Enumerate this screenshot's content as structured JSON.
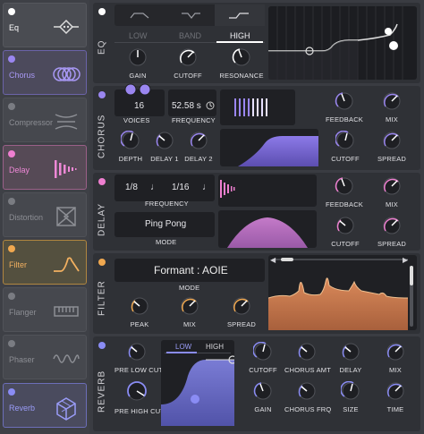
{
  "sidebar": {
    "modules": [
      {
        "label": "Eq",
        "active": true,
        "dot": "#ffffff",
        "label_color": "#ffffff"
      },
      {
        "label": "Chorus",
        "active": true,
        "dot": "#9a86f0",
        "label_color": "#a898f4"
      },
      {
        "label": "Compressor",
        "active": false,
        "dot": "#7a7c82",
        "label_color": "#8c8e94"
      },
      {
        "label": "Delay",
        "active": true,
        "dot": "#ee7fd0",
        "label_color": "#ee88d6"
      },
      {
        "label": "Distortion",
        "active": false,
        "dot": "#7a7c82",
        "label_color": "#8c8e94"
      },
      {
        "label": "Filter",
        "active": true,
        "dot": "#f0a850",
        "label_color": "#f2b060"
      },
      {
        "label": "Flanger",
        "active": false,
        "dot": "#7a7c82",
        "label_color": "#8c8e94"
      },
      {
        "label": "Phaser",
        "active": false,
        "dot": "#7a7c82",
        "label_color": "#8c8e94"
      },
      {
        "label": "Reverb",
        "active": true,
        "dot": "#8a8cf4",
        "label_color": "#9a9cf8"
      }
    ]
  },
  "eq": {
    "title": "EQ",
    "bands": [
      "LOW",
      "BAND",
      "HIGH"
    ],
    "selected_band": "HIGH",
    "knobs": [
      "GAIN",
      "CUTOFF",
      "RESONANCE"
    ]
  },
  "chorus": {
    "title": "CHORUS",
    "voices_value": "16",
    "voices_label": "VOICES",
    "frequency_value": "52.58 s",
    "frequency_label": "FREQUENCY",
    "knobs_right": [
      "FEEDBACK",
      "MIX"
    ],
    "knobs_bottom": [
      "DEPTH",
      "DELAY 1",
      "DELAY 2"
    ],
    "knobs_bottom_right": [
      "CUTOFF",
      "SPREAD"
    ]
  },
  "delay": {
    "title": "DELAY",
    "time1": "1/8",
    "time2": "1/16",
    "frequency_label": "FREQUENCY",
    "mode_value": "Ping Pong",
    "mode_label": "MODE",
    "knobs_right": [
      "FEEDBACK",
      "MIX"
    ],
    "knobs_bottom_right": [
      "CUTOFF",
      "SPREAD"
    ]
  },
  "filter": {
    "title": "FILTER",
    "mode_value": "Formant : AOIE",
    "mode_label": "MODE",
    "knobs": [
      "PEAK",
      "MIX",
      "SPREAD"
    ]
  },
  "reverb": {
    "title": "REVERB",
    "knobs_left": [
      "PRE LOW CUT",
      "PRE HIGH CUT"
    ],
    "tabs": [
      "LOW",
      "HIGH"
    ],
    "selected_tab": "LOW",
    "knobs_top": [
      "CUTOFF",
      "CHORUS AMT",
      "DELAY",
      "MIX"
    ],
    "knobs_bottom": [
      "GAIN",
      "CHORUS FRQ",
      "SIZE",
      "TIME"
    ]
  },
  "colors": {
    "eq": "#ffffff",
    "chorus": "#9a86f0",
    "delay": "#ee7fd0",
    "filter": "#f0a850",
    "reverb": "#8a8cf4"
  }
}
